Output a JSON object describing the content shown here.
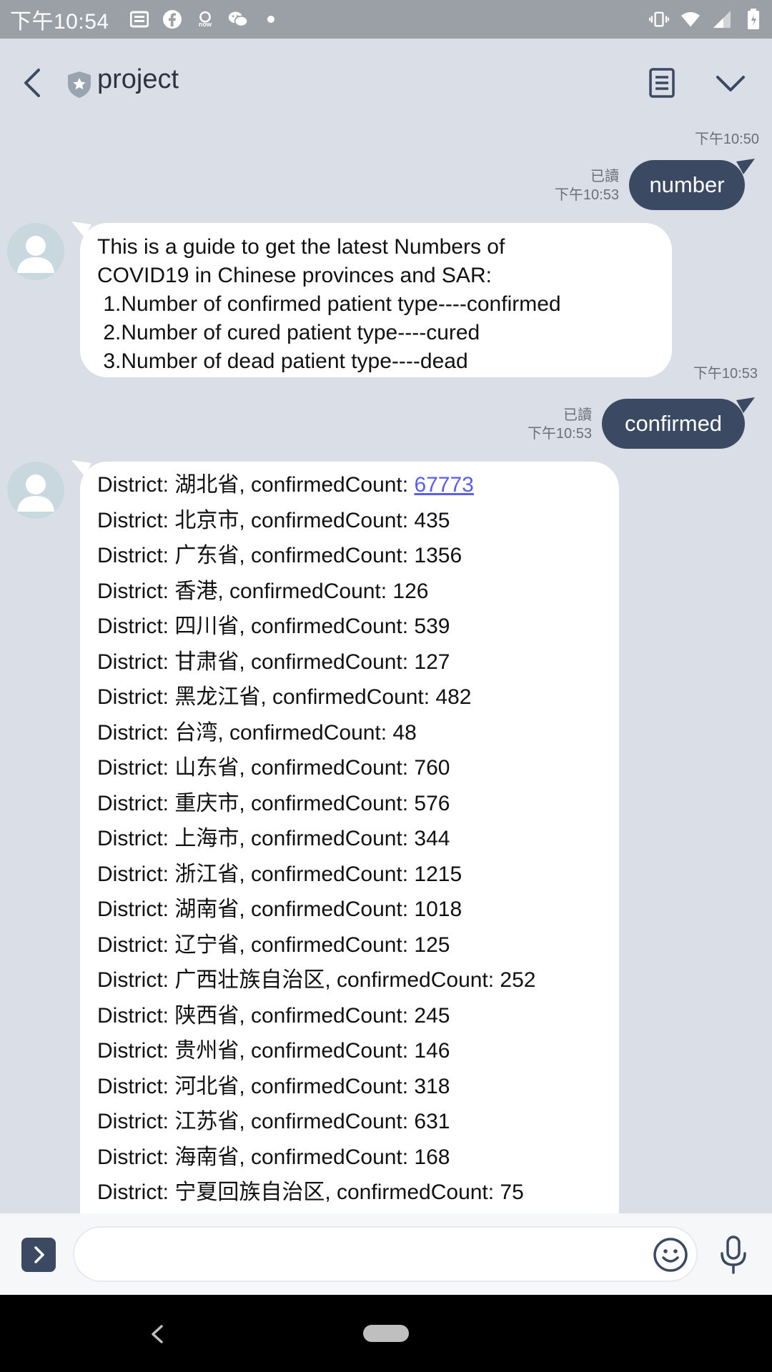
{
  "status_bar": {
    "time": "下午10:54"
  },
  "header": {
    "title": "project"
  },
  "messages": {
    "ts1": "下午10:50",
    "out1": {
      "read": "已讀",
      "time": "下午10:53",
      "text": "number"
    },
    "in1": {
      "lines": [
        "This is a guide to get the latest Numbers of",
        "COVID19 in Chinese provinces and SAR:",
        " 1.Number of confirmed patient type----confirmed",
        " 2.Number of cured patient type----cured",
        " 3.Number of dead patient type----dead"
      ],
      "time": "下午10:53"
    },
    "out2": {
      "read": "已讀",
      "time": "下午10:53",
      "text": "confirmed"
    },
    "in2": {
      "first_prefix": "District: 湖北省, confirmedCount: ",
      "first_link": "67773",
      "lines": [
        "District: 北京市, confirmedCount: 435",
        "District: 广东省, confirmedCount: 1356",
        "District: 香港, confirmedCount: 126",
        "District: 四川省, confirmedCount: 539",
        "District: 甘肃省, confirmedCount: 127",
        "District: 黑龙江省, confirmedCount: 482",
        "District: 台湾, confirmedCount: 48",
        "District: 山东省, confirmedCount: 760",
        "District: 重庆市, confirmedCount: 576",
        "District: 上海市, confirmedCount: 344",
        "District: 浙江省, confirmedCount: 1215",
        "District: 湖南省, confirmedCount: 1018",
        "District: 辽宁省, confirmedCount: 125",
        "District: 广西壮族自治区, confirmedCount: 252",
        "District: 陕西省, confirmedCount: 245",
        "District: 贵州省, confirmedCount: 146",
        "District: 河北省, confirmedCount: 318",
        "District: 江苏省, confirmedCount: 631",
        "District: 海南省, confirmedCount: 168",
        "District: 宁夏回族自治区, confirmedCount: 75"
      ]
    }
  },
  "icons": {
    "status_left": [
      "news-icon",
      "facebook-icon",
      "now-icon",
      "wechat-icon",
      "dot-icon"
    ],
    "status_right": [
      "vibrate-icon",
      "wifi-icon",
      "signal-icon",
      "battery-icon"
    ]
  },
  "colors": {
    "outgoing_bubble": "#3b4a62",
    "incoming_bubble": "#ffffff",
    "chat_bg": "#d9dee7",
    "link": "#5a5ef0"
  }
}
